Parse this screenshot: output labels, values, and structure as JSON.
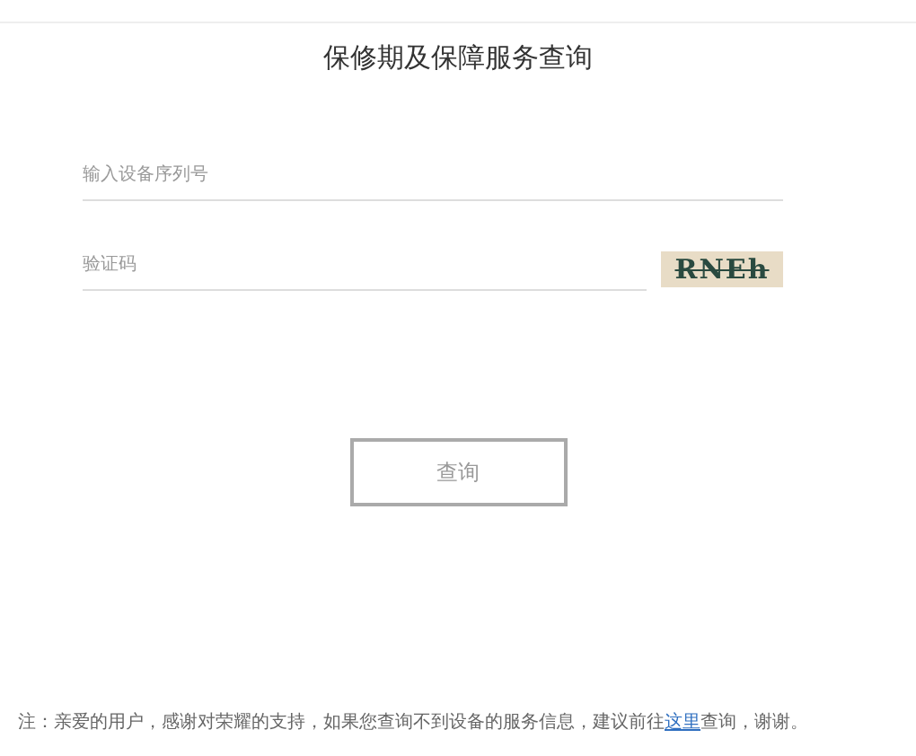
{
  "title": "保修期及保障服务查询",
  "serial_field": {
    "placeholder": "输入设备序列号"
  },
  "captcha_field": {
    "placeholder": "验证码"
  },
  "captcha_image": {
    "text": "RNEh"
  },
  "query_button": {
    "label": "查询"
  },
  "note": {
    "before": "注：亲爱的用户，感谢对荣耀的支持，如果您查询不到设备的服务信息，建议前往",
    "link": "这里",
    "after": "查询，谢谢。"
  }
}
